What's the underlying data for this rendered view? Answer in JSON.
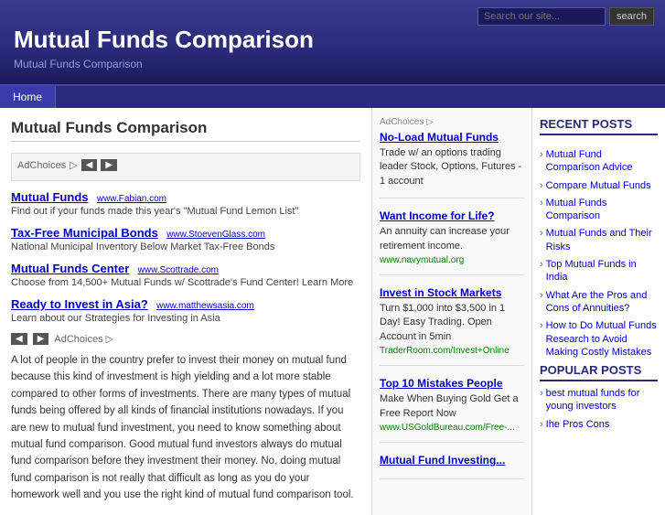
{
  "header": {
    "title": "Mutual Funds Comparison",
    "subtitle": "Mutual Funds Comparison",
    "search_placeholder": "Search our site...",
    "search_button": "search"
  },
  "nav": {
    "items": [
      "Home"
    ]
  },
  "main": {
    "heading": "Mutual Funds Comparison",
    "ad_label": "AdChoices",
    "ad_label2": "AdChoices ▷",
    "links": [
      {
        "main": "Mutual Funds",
        "sub_url": "www.Fabian.com",
        "desc": "Find out if your funds made this year's \"Mutual Fund Lemon List\""
      },
      {
        "main": "Tax-Free Municipal Bonds",
        "sub_url": "www.StoevenGlass.com",
        "desc": "National Municipal Inventory Below Market Tax-Free Bonds"
      },
      {
        "main": "Mutual Funds Center",
        "sub_url": "www.Scottrade.com",
        "desc": "Choose from 14,500+ Mutual Funds w/ Scottrade's Fund Center! Learn More"
      },
      {
        "main": "Ready to Invest in Asia?",
        "sub_url": "www.matthewsasia.com",
        "desc": "Learn about our Strategies for Investing in Asia"
      }
    ],
    "body_text": "A lot of people in the country prefer to invest their money on mutual fund because this kind of investment is high yielding and a lot more stable compared to other forms of investments. There are many types of mutual funds being offered by all kinds of financial institutions nowadays. If you are new to mutual fund investment, you need to know something about mutual fund comparison. Good mutual fund investors always do mutual fund comparison before they investment their money. No, doing mutual fund comparison is not really that difficult as long as you do your homework well and you use the right kind of mutual fund comparison tool."
  },
  "middle_ads": {
    "label": "AdChoices ▷",
    "blocks": [
      {
        "title": "No-Load Mutual Funds",
        "desc": "Trade w/ an options trading leader Stock, Options, Futures - 1 account",
        "url": ""
      },
      {
        "title": "Want Income for Life?",
        "desc": "An annuity can increase your retirement income.",
        "url": "www.navymutual.org"
      },
      {
        "title": "Invest in Stock Markets",
        "desc": "Turn $1,000 into $3,500 in 1 Day! Easy Trading. Open Account in 5min",
        "url": "TraderRoom.com/Invest+Online"
      },
      {
        "title": "Top 10 Mistakes People",
        "desc": "Make When Buying Gold Get a Free Report Now",
        "url": "www.USGoldBureau.com/Free-..."
      },
      {
        "title": "Mutual Fund Investing...",
        "desc": "",
        "url": ""
      }
    ]
  },
  "sidebar": {
    "recent_title": "RECENT POSTS",
    "recent_links": [
      "Mutual Fund Comparison Advice",
      "Compare Mutual Funds",
      "Mutual Funds Comparison",
      "Mutual Funds and Their Risks",
      "Top Mutual Funds in India",
      "What Are the Pros and Cons of Annuities?",
      "How to Do Mutual Funds Research to Avoid Making Costly Mistakes"
    ],
    "popular_title": "POPULAR POSTS",
    "popular_links": [
      "best mutual funds for young investors",
      "Ihe Pros Cons"
    ]
  }
}
